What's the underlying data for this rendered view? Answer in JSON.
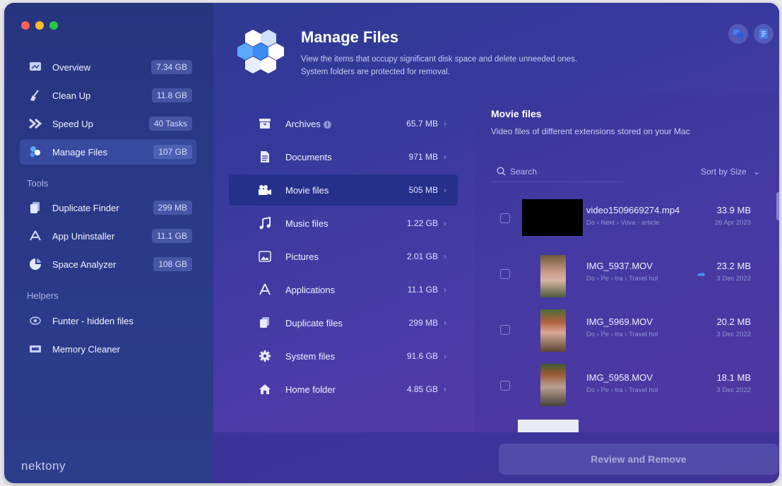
{
  "sidebar": {
    "items": [
      {
        "label": "Overview",
        "badge": "7.34 GB",
        "icon": "overview-icon"
      },
      {
        "label": "Clean Up",
        "badge": "11.8 GB",
        "icon": "broom-icon"
      },
      {
        "label": "Speed Up",
        "badge": "40 Tasks",
        "icon": "speed-icon"
      },
      {
        "label": "Manage Files",
        "badge": "107 GB",
        "icon": "manage-files-icon"
      }
    ],
    "tools_heading": "Tools",
    "tools": [
      {
        "label": "Duplicate Finder",
        "badge": "299 MB",
        "icon": "duplicate-finder-icon"
      },
      {
        "label": "App Uninstaller",
        "badge": "11.1 GB",
        "icon": "app-uninstaller-icon"
      },
      {
        "label": "Space Analyzer",
        "badge": "108 GB",
        "icon": "space-analyzer-icon"
      }
    ],
    "helpers_heading": "Helpers",
    "helpers": [
      {
        "label": "Funter - hidden files",
        "icon": "eye-icon"
      },
      {
        "label": "Memory Cleaner",
        "icon": "memory-icon"
      }
    ],
    "brand": "nektony"
  },
  "header": {
    "title": "Manage Files",
    "description_line1": "View the items that occupy significant disk space and delete unneeded ones.",
    "description_line2": "System folders are protected for removal."
  },
  "categories": [
    {
      "label": "Archives",
      "size": "65.7 MB",
      "icon": "archive-icon"
    },
    {
      "label": "Documents",
      "size": "971 MB",
      "icon": "document-icon"
    },
    {
      "label": "Movie files",
      "size": "505 MB",
      "icon": "movie-icon"
    },
    {
      "label": "Music files",
      "size": "1.22 GB",
      "icon": "music-icon"
    },
    {
      "label": "Pictures",
      "size": "2.01 GB",
      "icon": "picture-icon"
    },
    {
      "label": "Applications",
      "size": "11.1 GB",
      "icon": "applications-icon"
    },
    {
      "label": "Duplicate files",
      "size": "299 MB",
      "icon": "duplicate-icon"
    },
    {
      "label": "System files",
      "size": "91.6 GB",
      "icon": "gear-icon"
    },
    {
      "label": "Home folder",
      "size": "4.85 GB",
      "icon": "home-icon"
    }
  ],
  "files_pane": {
    "title": "Movie files",
    "description": "Video files of different extensions stored on your Mac",
    "search_placeholder": "Search",
    "sort_label": "Sort by Size",
    "files": [
      {
        "name": "video1509669274.mp4",
        "path": "Do › Nekt › Vova - article",
        "size": "33.9 MB",
        "date": "26 Apr 2023"
      },
      {
        "name": "IMG_5937.MOV",
        "path": "Do › Pe › tra › Travel hol",
        "size": "23.2 MB",
        "date": "3 Dec 2022"
      },
      {
        "name": "IMG_5969.MOV",
        "path": "Do › Pe › tra › Travel hol",
        "size": "20.2 MB",
        "date": "3 Dec 2022"
      },
      {
        "name": "IMG_5958.MOV",
        "path": "Do › Pe › tra › Travel hol",
        "size": "18.1 MB",
        "date": "3 Dec 2022"
      }
    ]
  },
  "actions": {
    "review_button": "Review and Remove"
  }
}
